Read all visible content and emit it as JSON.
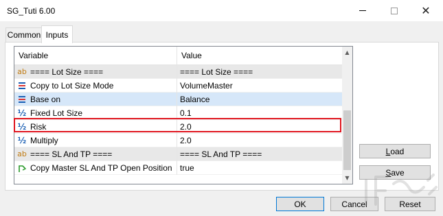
{
  "window": {
    "title": "SG_Tuti 6.00"
  },
  "tabs": [
    {
      "label": "Common",
      "active": false
    },
    {
      "label": "Inputs",
      "active": true
    }
  ],
  "grid": {
    "columns": [
      "Variable",
      "Value"
    ],
    "rows": [
      {
        "icon": "text-icon",
        "variable": "==== Lot Size ====",
        "value": "==== Lot Size ====",
        "separator": true
      },
      {
        "icon": "enum-icon",
        "variable": "Copy to Lot Size Mode",
        "value": "VolumeMaster"
      },
      {
        "icon": "enum-icon",
        "variable": "Base on",
        "value": "Balance",
        "selected": true
      },
      {
        "icon": "fraction-icon",
        "variable": "Fixed Lot Size",
        "value": "0.1"
      },
      {
        "icon": "fraction-icon",
        "variable": "Risk",
        "value": "2.0",
        "highlighted": true
      },
      {
        "icon": "fraction-icon",
        "variable": "Multiply",
        "value": "2.0"
      },
      {
        "icon": "text-icon",
        "variable": "==== SL And TP ====",
        "value": "==== SL And TP ====",
        "separator": true
      },
      {
        "icon": "boolean-icon",
        "variable": "Copy Master SL And TP Open Position",
        "value": "true"
      }
    ]
  },
  "buttons": {
    "load": {
      "underline": "L",
      "rest": "oad"
    },
    "save": {
      "underline": "S",
      "rest": "ave"
    },
    "ok": "OK",
    "cancel": "Cancel",
    "reset": "Reset"
  },
  "colors": {
    "highlight_border": "#e0141e",
    "selected_row": "#d6e7f9",
    "separator_row": "#e8e8e8",
    "ok_border": "#0078d7"
  }
}
